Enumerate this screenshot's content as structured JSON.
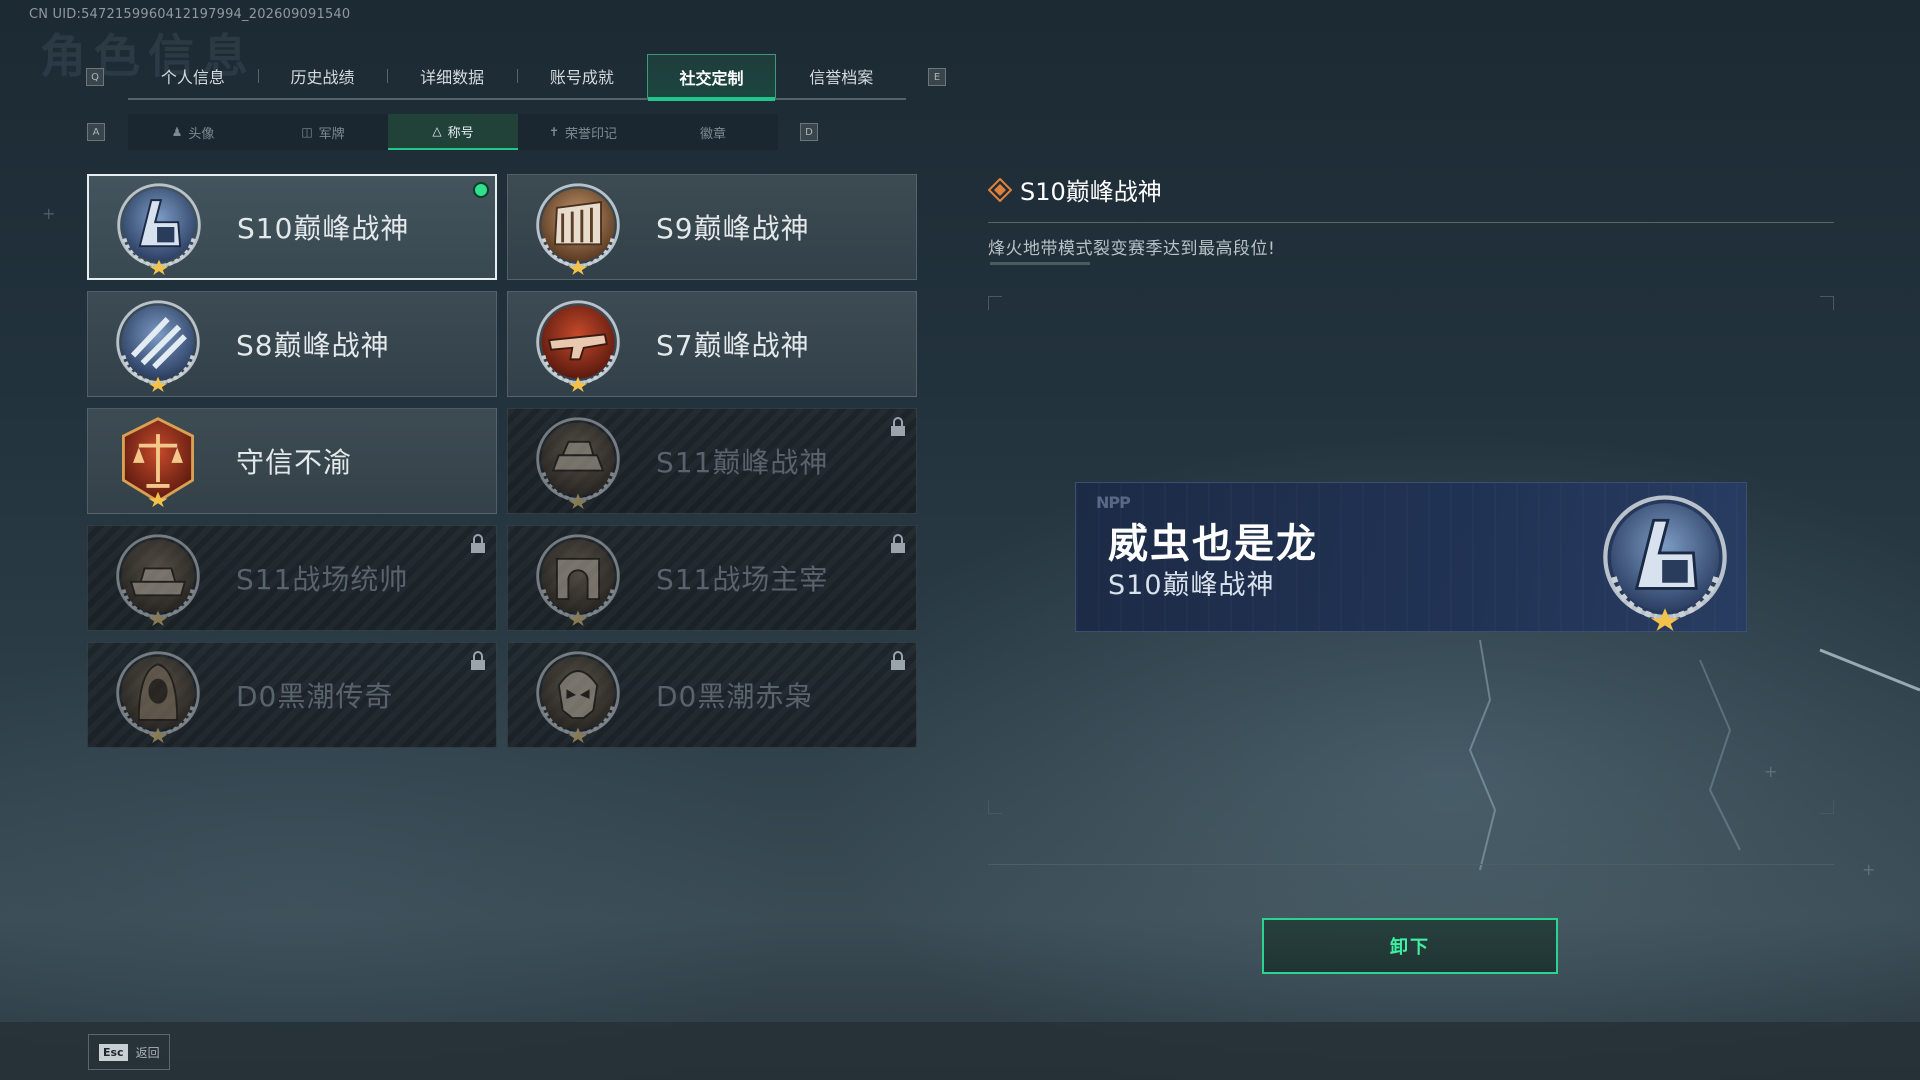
{
  "uid_text": "CN UID:5472159960412197994_202609091540",
  "main_tabs": {
    "key_left": "Q",
    "key_right": "E",
    "items": [
      {
        "label": "个人信息"
      },
      {
        "label": "历史战绩"
      },
      {
        "label": "详细数据"
      },
      {
        "label": "账号成就"
      },
      {
        "label": "社交定制",
        "active": true
      },
      {
        "label": "信誉档案"
      }
    ]
  },
  "sub_tabs": {
    "key_left": "A",
    "key_right": "D",
    "items": [
      {
        "label": "头像",
        "icon": "person-icon"
      },
      {
        "label": "军牌",
        "icon": "dogtag-icon"
      },
      {
        "label": "称号",
        "icon": "triangle-icon",
        "active": true
      },
      {
        "label": "荣誉印记",
        "icon": "honor-mark-icon"
      },
      {
        "label": "徽章",
        "icon": ""
      }
    ]
  },
  "titles": [
    {
      "name": "S10巅峰战神",
      "badge": "s10-peak-badge-icon",
      "selected": true,
      "equipped": true,
      "locked": false
    },
    {
      "name": "S9巅峰战神",
      "badge": "s9-peak-badge-icon",
      "selected": false,
      "equipped": false,
      "locked": false
    },
    {
      "name": "S8巅峰战神",
      "badge": "s8-peak-badge-icon",
      "selected": false,
      "equipped": false,
      "locked": false
    },
    {
      "name": "S7巅峰战神",
      "badge": "s7-peak-badge-icon",
      "selected": false,
      "equipped": false,
      "locked": false
    },
    {
      "name": "守信不渝",
      "badge": "scales-badge-icon",
      "selected": false,
      "equipped": false,
      "locked": false
    },
    {
      "name": "S11巅峰战神",
      "badge": "s11-peak-badge-icon",
      "selected": false,
      "equipped": false,
      "locked": true
    },
    {
      "name": "S11战场统帅",
      "badge": "s11-tank-badge-icon",
      "selected": false,
      "equipped": false,
      "locked": true
    },
    {
      "name": "S11战场主宰",
      "badge": "s11-arch-badge-icon",
      "selected": false,
      "equipped": false,
      "locked": true
    },
    {
      "name": "D0黑潮传奇",
      "badge": "d0-hooded-badge-icon",
      "selected": false,
      "equipped": false,
      "locked": true
    },
    {
      "name": "D0黑潮赤枭",
      "badge": "d0-skull-badge-icon",
      "selected": false,
      "equipped": false,
      "locked": true
    }
  ],
  "detail": {
    "title": "S10巅峰战神",
    "description": "烽火地带模式裂变赛季达到最高段位!"
  },
  "preview": {
    "brand": "NPP",
    "player_name": "威虫也是龙",
    "title": "S10巅峰战神"
  },
  "unequip_label": "卸下",
  "footer": {
    "esc_key": "Esc",
    "esc_label": "返回"
  },
  "colors": {
    "accent_green": "#2bd48e",
    "equipped_dot": "#2fe08c",
    "active_tab_bg": "#1f3c3b",
    "preview_bg": "#20325a"
  }
}
